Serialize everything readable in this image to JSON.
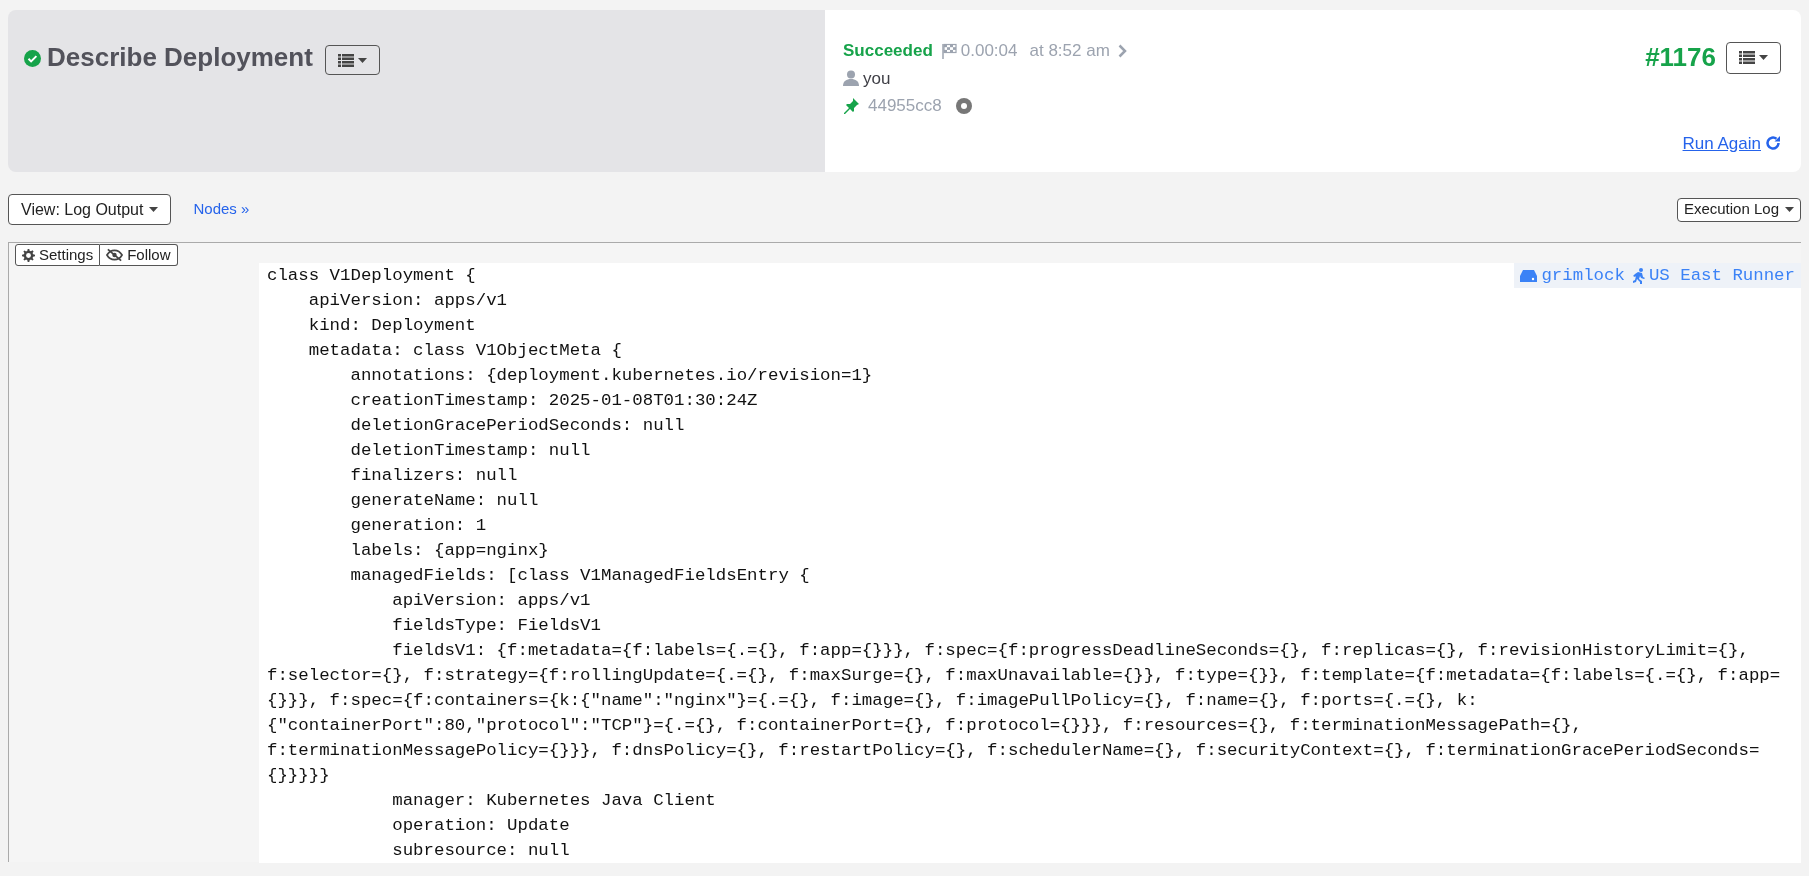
{
  "job": {
    "title": "Describe Deployment",
    "succeeded": true
  },
  "execution": {
    "status_label": "Succeeded",
    "duration": "0.00:04",
    "started": "at 8:52 am",
    "user": "you",
    "commit": "44955cc8",
    "number": "#1176",
    "run_again": "Run Again"
  },
  "toolbar": {
    "view": "View: Log Output",
    "nodes": "Nodes »",
    "log_menu": "Execution Log"
  },
  "log": {
    "settings": "Settings",
    "follow": "Follow",
    "node": "grimlock",
    "runner": "US East Runner",
    "lines": [
      {
        "text": "class V1Deployment {",
        "children": [
          {
            "text": "apiVersion: apps/v1"
          },
          {
            "text": "kind: Deployment"
          },
          {
            "text": "metadata: class V1ObjectMeta {",
            "children": [
              {
                "text": "annotations: {deployment.kubernetes.io/revision=1}"
              },
              {
                "text": "creationTimestamp: 2025-01-08T01:30:24Z"
              },
              {
                "text": "deletionGracePeriodSeconds: null"
              },
              {
                "text": "deletionTimestamp: null"
              },
              {
                "text": "finalizers: null"
              },
              {
                "text": "generateName: null"
              },
              {
                "text": "generation: 1"
              },
              {
                "text": "labels: {app=nginx}"
              },
              {
                "text": "managedFields: [class V1ManagedFieldsEntry {",
                "children": [
                  {
                    "text": "apiVersion: apps/v1"
                  },
                  {
                    "text": "fieldsType: FieldsV1"
                  },
                  {
                    "text": "fieldsV1: {f:metadata={f:labels={.={}, f:app={}}}, f:spec={f:progressDeadlineSeconds={}, f:replicas={}, f:revisionHistoryLimit={}, f:selector={}, f:strategy={f:rollingUpdate={.={}, f:maxSurge={}, f:maxUnavailable={}}, f:type={}}, f:template={f:metadata={f:labels={.={}, f:app={}}}, f:spec={f:containers={k:{\"name\":\"nginx\"}={.={}, f:image={}, f:imagePullPolicy={}, f:name={}, f:ports={.={}, k:{\"containerPort\":80,\"protocol\":\"TCP\"}={.={}, f:containerPort={}, f:protocol={}}}, f:resources={}, f:terminationMessagePath={}, f:terminationMessagePolicy={}}}, f:dnsPolicy={}, f:restartPolicy={}, f:schedulerName={}, f:securityContext={}, f:terminationGracePeriodSeconds={}}}}}"
                  },
                  {
                    "text": "manager: Kubernetes Java Client"
                  },
                  {
                    "text": "operation: Update"
                  },
                  {
                    "text": "subresource: null"
                  }
                ]
              }
            ]
          }
        ]
      }
    ]
  }
}
